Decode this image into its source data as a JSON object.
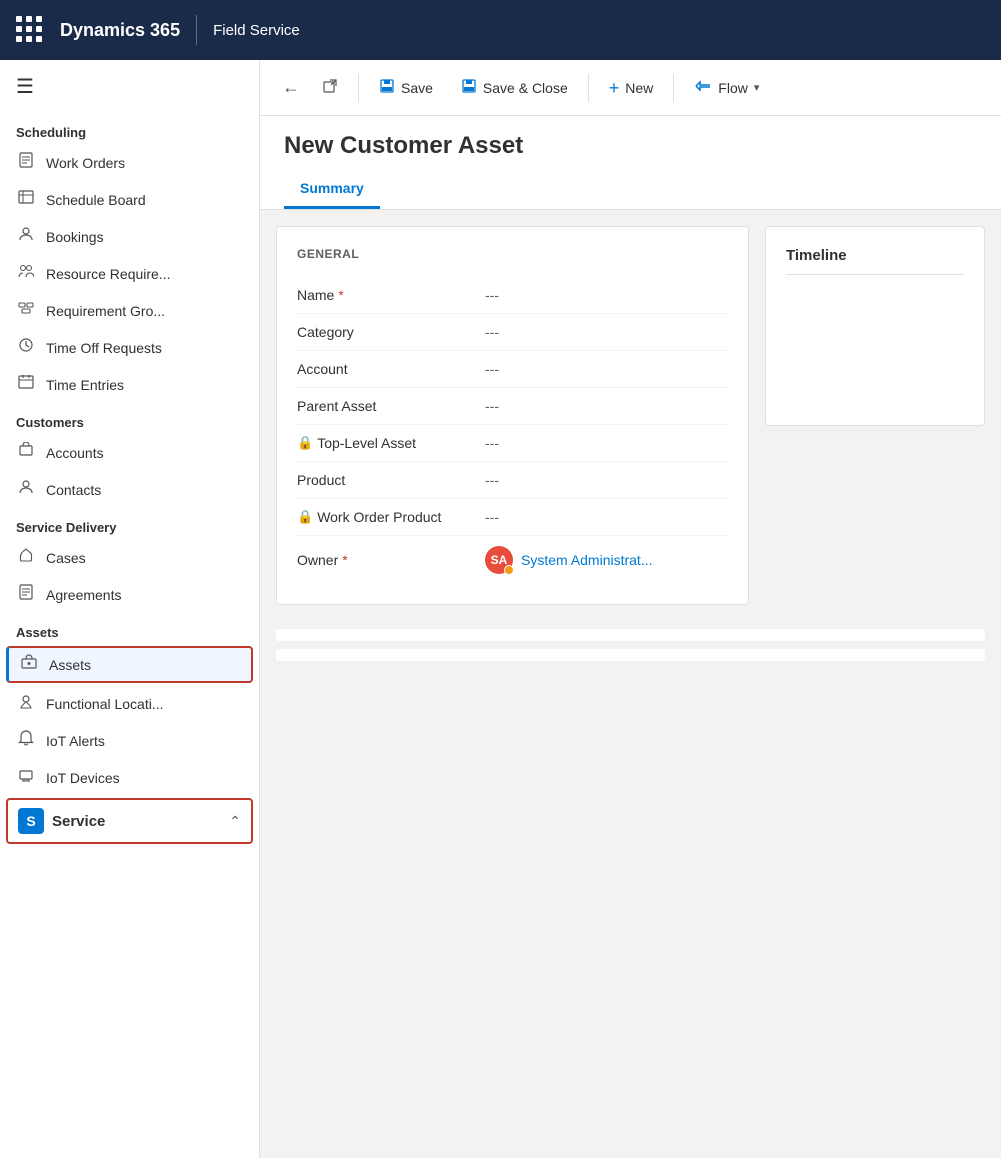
{
  "topbar": {
    "app_name": "Dynamics 365",
    "module_name": "Field Service"
  },
  "sidebar": {
    "hamburger_icon": "☰",
    "sections": [
      {
        "label": "Scheduling",
        "items": [
          {
            "id": "work-orders",
            "icon": "📋",
            "label": "Work Orders"
          },
          {
            "id": "schedule-board",
            "icon": "📅",
            "label": "Schedule Board"
          },
          {
            "id": "bookings",
            "icon": "👤",
            "label": "Bookings"
          },
          {
            "id": "resource-requirements",
            "icon": "👥",
            "label": "Resource Require..."
          },
          {
            "id": "requirement-groups",
            "icon": "🗃",
            "label": "Requirement Gro..."
          },
          {
            "id": "time-off-requests",
            "icon": "🕐",
            "label": "Time Off Requests"
          },
          {
            "id": "time-entries",
            "icon": "📆",
            "label": "Time Entries"
          }
        ]
      },
      {
        "label": "Customers",
        "items": [
          {
            "id": "accounts",
            "icon": "🏢",
            "label": "Accounts"
          },
          {
            "id": "contacts",
            "icon": "👤",
            "label": "Contacts"
          }
        ]
      },
      {
        "label": "Service Delivery",
        "items": [
          {
            "id": "cases",
            "icon": "🔧",
            "label": "Cases"
          },
          {
            "id": "agreements",
            "icon": "📄",
            "label": "Agreements"
          }
        ]
      },
      {
        "label": "Assets",
        "items": [
          {
            "id": "assets",
            "icon": "📦",
            "label": "Assets",
            "selected": true
          },
          {
            "id": "functional-locations",
            "icon": "📍",
            "label": "Functional Locati..."
          },
          {
            "id": "iot-alerts",
            "icon": "📡",
            "label": "IoT Alerts"
          },
          {
            "id": "iot-devices",
            "icon": "📟",
            "label": "IoT Devices"
          }
        ]
      }
    ],
    "bottom_item": {
      "badge": "S",
      "label": "Service",
      "chevron": "⌃"
    }
  },
  "toolbar": {
    "back_icon": "←",
    "external_link_icon": "⧉",
    "save_label": "Save",
    "save_icon": "💾",
    "save_close_label": "Save & Close",
    "save_close_icon": "💾",
    "new_label": "New",
    "new_icon": "+",
    "flow_label": "Flow",
    "flow_icon": "⟫",
    "flow_chevron": "∨"
  },
  "page": {
    "title": "New Customer Asset",
    "tabs": [
      {
        "id": "summary",
        "label": "Summary",
        "active": true
      }
    ]
  },
  "form": {
    "section_title": "GENERAL",
    "fields": [
      {
        "label": "Name",
        "required": true,
        "locked": false,
        "value": "---"
      },
      {
        "label": "Category",
        "required": false,
        "locked": false,
        "value": "---"
      },
      {
        "label": "Account",
        "required": false,
        "locked": false,
        "value": "---"
      },
      {
        "label": "Parent Asset",
        "required": false,
        "locked": false,
        "value": "---"
      },
      {
        "label": "Top-Level Asset",
        "required": false,
        "locked": true,
        "value": "---"
      },
      {
        "label": "Product",
        "required": false,
        "locked": false,
        "value": "---"
      },
      {
        "label": "Work Order Product",
        "required": false,
        "locked": true,
        "value": "---"
      },
      {
        "label": "Owner",
        "required": true,
        "locked": false,
        "value": "System Administrat...",
        "is_owner": true,
        "avatar_initials": "SA"
      }
    ]
  },
  "timeline": {
    "title": "Timeline"
  }
}
